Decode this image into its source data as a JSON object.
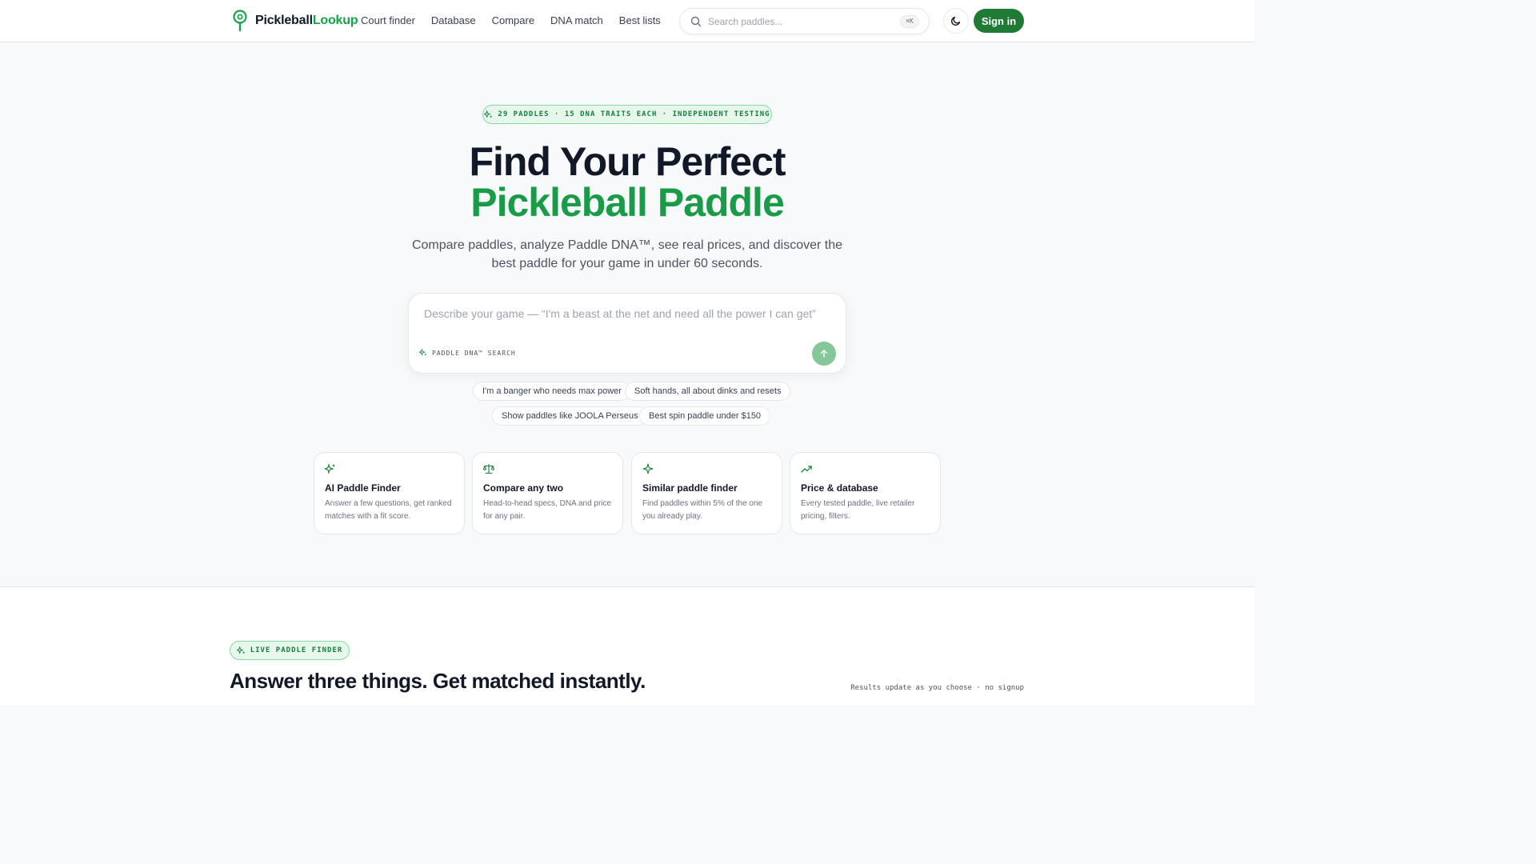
{
  "header": {
    "brand_part1": "Pickleball",
    "brand_part2": "Lookup",
    "nav": [
      "Court finder",
      "Database",
      "Compare",
      "DNA match",
      "Best lists"
    ],
    "search_placeholder": "Search paddles...",
    "search_shortcut": "⌘K",
    "signin_label": "Sign in"
  },
  "hero": {
    "pill": "29 PADDLES · 15 DNA TRAITS EACH · INDEPENDENT TESTING",
    "title_line1": "Find Your Perfect",
    "title_line2": "Pickleball Paddle",
    "subtitle": "Compare paddles, analyze Paddle DNA™, see real prices, and discover the best paddle for your game in under 60 seconds.",
    "ai_placeholder": "Describe your game — “I'm a beast at the net and need all the power I can get”",
    "ai_label": "PADDLE DNA™ SEARCH",
    "suggestions": [
      "I'm a banger who needs max power",
      "Soft hands, all about dinks and resets",
      "Show paddles like JOOLA Perseus",
      "Best spin paddle under $150"
    ]
  },
  "features": [
    {
      "icon": "sparkles-icon",
      "title": "AI Paddle Finder",
      "desc": "Answer a few questions, get ranked matches with a fit score."
    },
    {
      "icon": "scale-icon",
      "title": "Compare any two",
      "desc": "Head-to-head specs, DNA and price for any pair."
    },
    {
      "icon": "sparkle-icon",
      "title": "Similar paddle finder",
      "desc": "Find paddles within 5% of the one you already play."
    },
    {
      "icon": "trending-up-icon",
      "title": "Price & database",
      "desc": "Every tested paddle, live retailer pricing, filters."
    }
  ],
  "finder": {
    "pill": "LIVE PADDLE FINDER",
    "title": "Answer three things. Get matched instantly.",
    "note": "Results update as you choose · no signup"
  },
  "colors": {
    "brand_green": "#16a34a",
    "button_green": "#1f7a35",
    "title_green": "#1a9b48"
  }
}
